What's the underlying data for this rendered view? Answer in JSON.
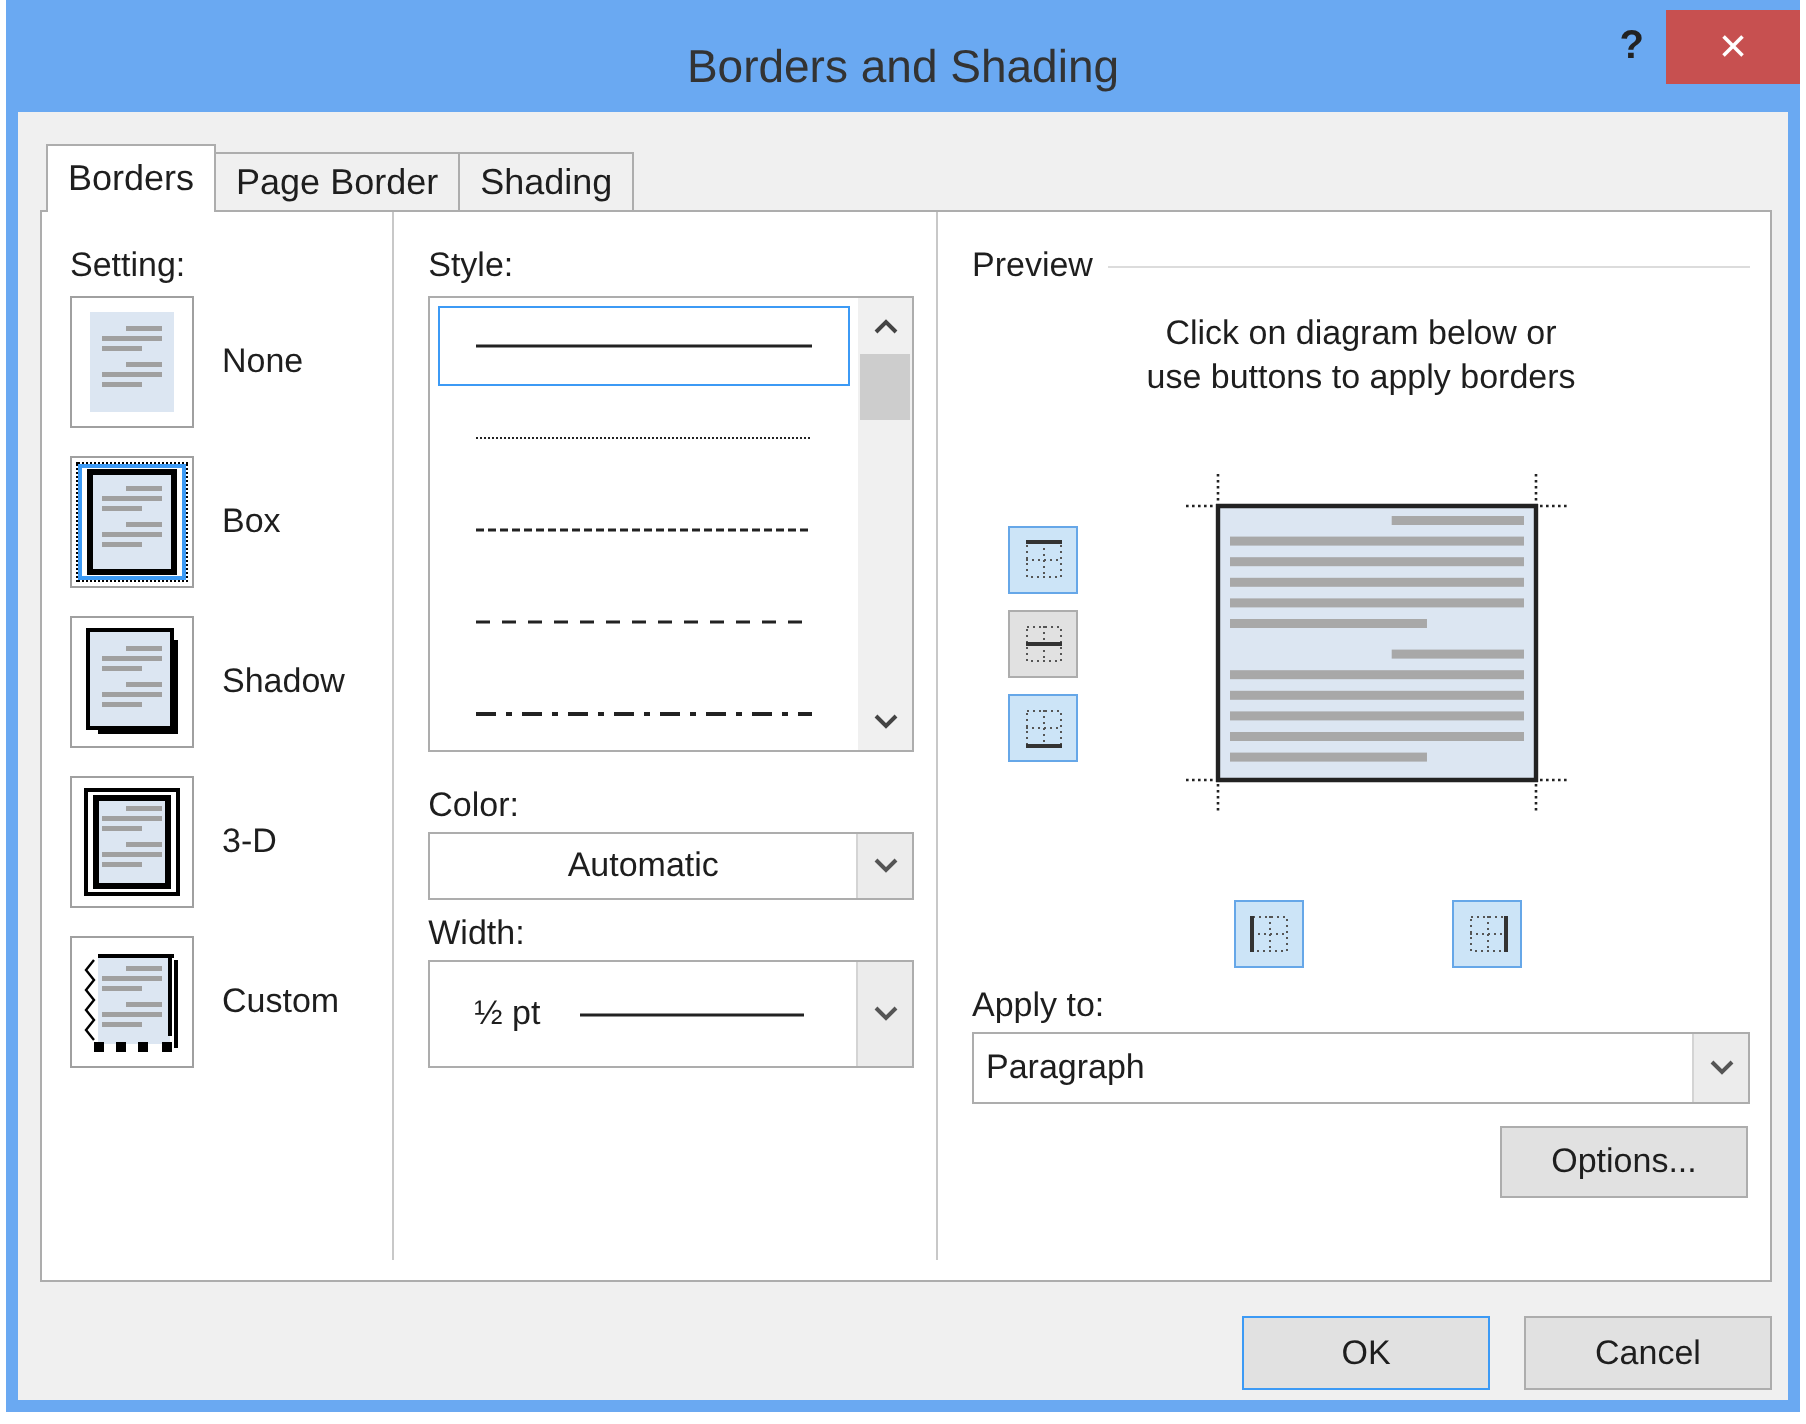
{
  "window": {
    "title": "Borders and Shading",
    "help": "?",
    "close": "×"
  },
  "tabs": [
    {
      "label": "Borders",
      "selected": true
    },
    {
      "label": "Page Border",
      "selected": false
    },
    {
      "label": "Shading",
      "selected": false
    }
  ],
  "setting": {
    "label": "Setting:",
    "options": [
      {
        "kind": "none",
        "label": "None",
        "selected": false
      },
      {
        "kind": "box",
        "label": "Box",
        "selected": true
      },
      {
        "kind": "shadow",
        "label": "Shadow",
        "selected": false
      },
      {
        "kind": "double",
        "label": "3-D",
        "selected": false
      },
      {
        "kind": "custom",
        "label": "Custom",
        "selected": false
      }
    ]
  },
  "style": {
    "label": "Style:",
    "options": [
      {
        "kind": "solid",
        "selected": true
      },
      {
        "kind": "dotted",
        "selected": false
      },
      {
        "kind": "dashed",
        "selected": false
      },
      {
        "kind": "longdash",
        "selected": false
      },
      {
        "kind": "dashdot",
        "selected": false
      }
    ]
  },
  "color": {
    "label": "Color:",
    "value": "Automatic"
  },
  "width": {
    "label": "Width:",
    "value": "½ pt"
  },
  "preview": {
    "label": "Preview",
    "instructions": "Click on diagram below or\nuse buttons to apply borders",
    "border_buttons": [
      {
        "kind": "top",
        "selected": true
      },
      {
        "kind": "middle",
        "selected": false
      },
      {
        "kind": "bottom",
        "selected": true
      },
      {
        "kind": "left",
        "selected": true
      },
      {
        "kind": "right",
        "selected": true
      }
    ]
  },
  "apply_to": {
    "label": "Apply to:",
    "value": "Paragraph"
  },
  "options_button": "Options...",
  "footer_buttons": [
    {
      "label": "OK",
      "default": true
    },
    {
      "label": "Cancel",
      "default": false
    }
  ]
}
